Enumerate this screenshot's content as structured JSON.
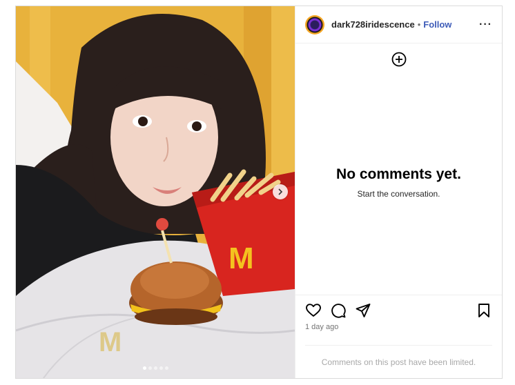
{
  "post": {
    "username": "dark728iridescence",
    "separator": "•",
    "follow_label": "Follow",
    "more_icon": "more-icon",
    "photo_description_hidden": null,
    "carousel": {
      "count": 5,
      "active_index": 0
    }
  },
  "comments": {
    "empty_title": "No comments yet.",
    "empty_subtitle": "Start the conversation."
  },
  "actions": {
    "icons": [
      "heart-icon",
      "comment-icon",
      "share-icon",
      "bookmark-icon"
    ],
    "timestamp": "1 day ago",
    "limited_notice": "Comments on this post have been limited."
  },
  "colors": {
    "follow_blue": "#3e5cb8",
    "border": "#dbdbdb",
    "muted": "#737373"
  }
}
